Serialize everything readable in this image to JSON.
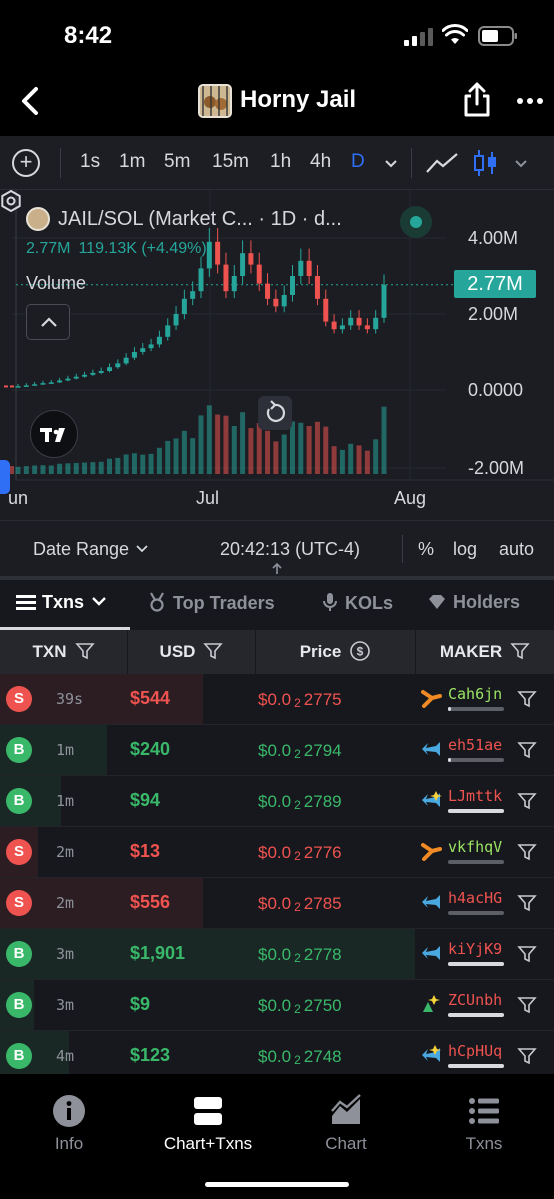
{
  "status_bar": {
    "time": "8:42"
  },
  "nav": {
    "title": "Horny Jail"
  },
  "toolbar": {
    "intervals": [
      "1s",
      "1m",
      "5m",
      "15m",
      "1h",
      "4h",
      "D"
    ],
    "active_interval": "D"
  },
  "chart": {
    "symbol_title": "JAIL/SOL (Market C... · 1D · d...",
    "legend_value": "2.77M",
    "legend_change": "119.13K (+4.49%)",
    "volume_label": "Volume",
    "y_ticks": [
      "4.00M",
      "2.00M",
      "0.0000",
      "-2.00M"
    ],
    "price_tag": "2.77M",
    "x_ticks": [
      "un",
      "Jul",
      "Aug"
    ],
    "colors": {
      "up": "#26a69a",
      "down": "#ef5350"
    }
  },
  "chart_data": {
    "type": "candlestick",
    "title": "JAIL/SOL (Market C... · 1D · d...",
    "x_ticks": [
      "un",
      "Jul",
      "Aug"
    ],
    "y_ticks": [
      "4.00M",
      "2.00M",
      "0.0000",
      "-2.00M"
    ],
    "last_price": "2.77M",
    "change": "119.13K (+4.49%)",
    "ylim": [
      -2000000,
      5200000
    ],
    "close_values": [
      0.1,
      0.12,
      0.15,
      0.18,
      0.2,
      0.25,
      0.3,
      0.35,
      0.4,
      0.45,
      0.5,
      0.6,
      0.7,
      0.85,
      1.0,
      1.1,
      1.2,
      1.4,
      1.7,
      2.0,
      2.4,
      2.6,
      3.2,
      3.9,
      3.3,
      2.6,
      3.0,
      3.6,
      3.3,
      2.8,
      2.4,
      2.2,
      2.5,
      3.0,
      3.4,
      3.0,
      2.4,
      1.8,
      1.6,
      1.7,
      1.9,
      1.7,
      1.6,
      1.9,
      2.77
    ]
  },
  "range_bar": {
    "date_range_label": "Date Range",
    "clock": "20:42:13 (UTC-4)",
    "percent": "%",
    "log": "log",
    "auto": "auto"
  },
  "tabs": [
    {
      "label": "Txns",
      "icon": "list-icon"
    },
    {
      "label": "Top Traders",
      "icon": "medal-icon"
    },
    {
      "label": "KOLs",
      "icon": "mic-icon"
    },
    {
      "label": "Holders",
      "icon": "diamond-icon"
    }
  ],
  "table": {
    "headers": [
      "TXN",
      "USD",
      "Price",
      "MAKER"
    ],
    "rows": [
      {
        "side": "S",
        "age": "39s",
        "usd": "$544",
        "price_pre": "$0.0",
        "price_sub": "2",
        "price_post": "2775",
        "maker": "Cah6jn",
        "maker_color": "#9be564",
        "wallet_fill": 0.05,
        "usd_fraction": 0.45
      },
      {
        "side": "B",
        "age": "1m",
        "usd": "$240",
        "price_pre": "$0.0",
        "price_sub": "2",
        "price_post": "2794",
        "maker": "eh51ae",
        "maker_color": "#ef5350",
        "wallet_fill": 0.05,
        "usd_fraction": 0.2
      },
      {
        "side": "B",
        "age": "1m",
        "usd": "$94",
        "price_pre": "$0.0",
        "price_sub": "2",
        "price_post": "2789",
        "maker": "LJmttk",
        "maker_color": "#ef5350",
        "wallet_fill": 1.0,
        "usd_fraction": 0.08
      },
      {
        "side": "S",
        "age": "2m",
        "usd": "$13",
        "price_pre": "$0.0",
        "price_sub": "2",
        "price_post": "2776",
        "maker": "vkfhqV",
        "maker_color": "#9be564",
        "wallet_fill": 0.0,
        "usd_fraction": 0.02
      },
      {
        "side": "S",
        "age": "2m",
        "usd": "$556",
        "price_pre": "$0.0",
        "price_sub": "2",
        "price_post": "2785",
        "maker": "h4acHG",
        "maker_color": "#ef5350",
        "wallet_fill": 0.0,
        "usd_fraction": 0.45
      },
      {
        "side": "B",
        "age": "3m",
        "usd": "$1,901",
        "price_pre": "$0.0",
        "price_sub": "2",
        "price_post": "2778",
        "maker": "kiYjK9",
        "maker_color": "#ef5350",
        "wallet_fill": 1.0,
        "usd_fraction": 1.0
      },
      {
        "side": "B",
        "age": "3m",
        "usd": "$9",
        "price_pre": "$0.0",
        "price_sub": "2",
        "price_post": "2750",
        "maker": "ZCUnbh",
        "maker_color": "#ef5350",
        "wallet_fill": 1.0,
        "usd_fraction": 0.01
      },
      {
        "side": "B",
        "age": "4m",
        "usd": "$123",
        "price_pre": "$0.0",
        "price_sub": "2",
        "price_post": "2748",
        "maker": "hCpHUq",
        "maker_color": "#ef5350",
        "wallet_fill": 1.0,
        "usd_fraction": 0.1
      }
    ]
  },
  "bottom_nav": [
    {
      "label": "Info",
      "icon": "info-icon"
    },
    {
      "label": "Chart+Txns",
      "icon": "split-icon",
      "active": true
    },
    {
      "label": "Chart",
      "icon": "chart-icon"
    },
    {
      "label": "Txns",
      "icon": "list-icon"
    }
  ]
}
